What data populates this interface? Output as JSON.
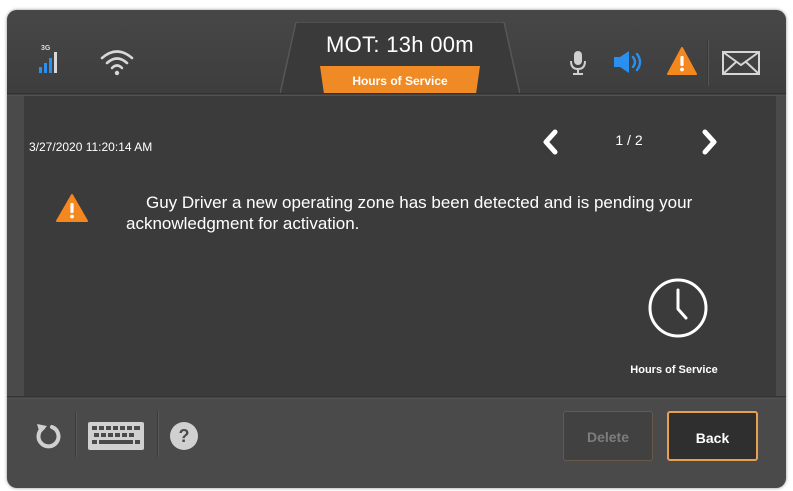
{
  "status_bar": {
    "network_type": "3G",
    "icons": [
      "signal-3g-icon",
      "wifi-icon",
      "microphone-icon",
      "speaker-icon",
      "alert-icon",
      "mail-icon"
    ],
    "colors": {
      "signal": "#2b8ff0",
      "speaker": "#2b8ff0",
      "alert": "#f5871f",
      "accent": "#f08a24"
    }
  },
  "header": {
    "mot_label": "MOT: 13h 00m",
    "tab_label": "Hours of Service"
  },
  "message": {
    "timestamp": "3/27/2020 11:20:14 AM",
    "page_indicator": "1 / 2",
    "text": "Guy Driver a new operating zone has been detected and is pending your acknowledgment for activation.",
    "source_label": "Hours of Service"
  },
  "toolbar": {
    "delete_label": "Delete",
    "back_label": "Back"
  }
}
